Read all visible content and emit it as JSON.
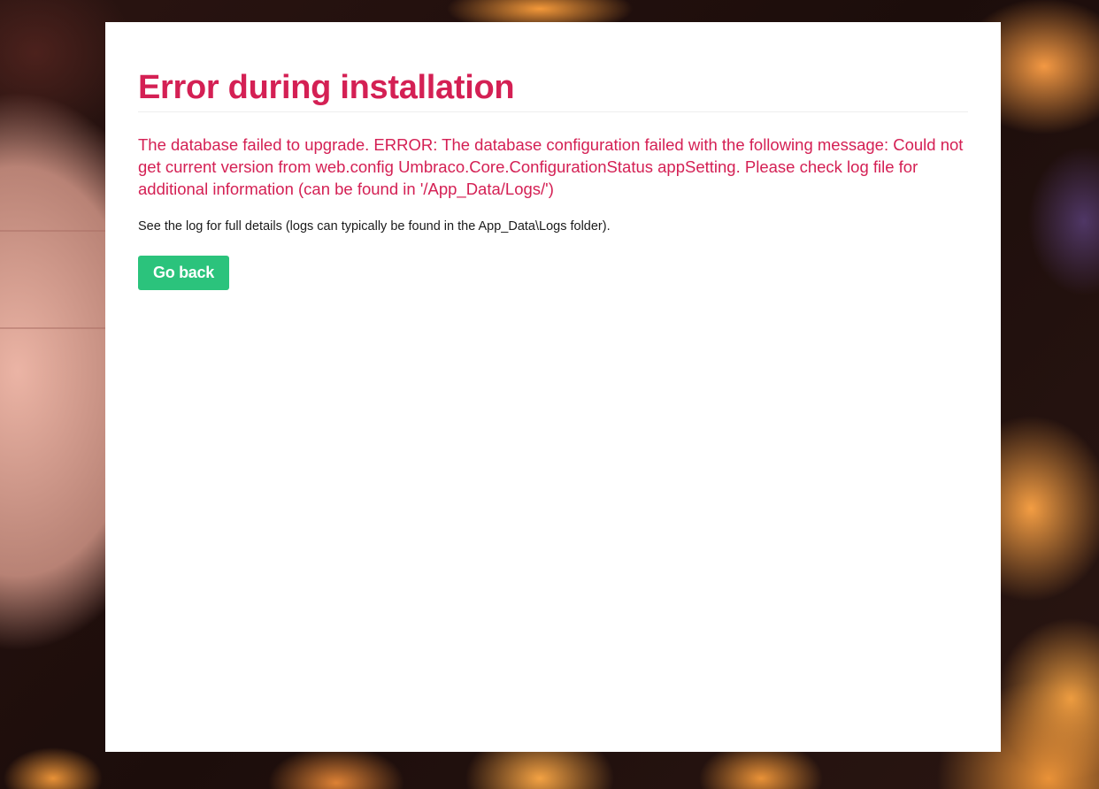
{
  "installer": {
    "title": "Error during installation",
    "error_message": "The database failed to upgrade. ERROR: The database configuration failed with the following message: Could not get current version from web.config Umbraco.Core.ConfigurationStatus appSetting. Please check log file for additional information (can be found in '/App_Data/Logs/')",
    "details": "See the log for full details (logs can typically be found in the App_Data\\Logs folder).",
    "go_back_label": "Go back"
  },
  "colors": {
    "error_red": "#d42054",
    "button_green": "#2bc37c",
    "card_background": "#ffffff"
  }
}
